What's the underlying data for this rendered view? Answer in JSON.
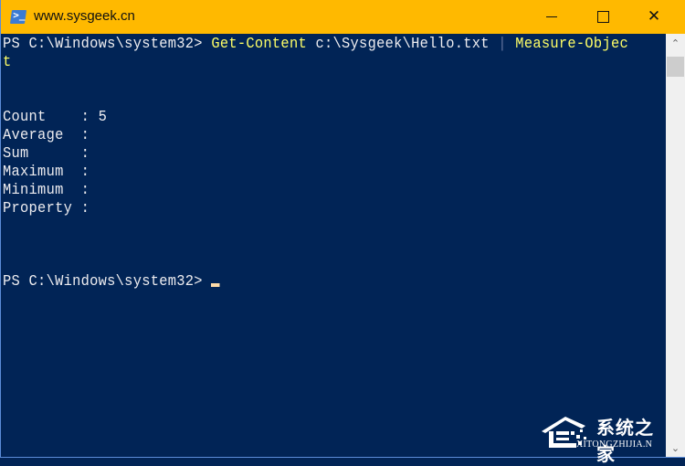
{
  "window": {
    "title": "www.sysgeek.cn",
    "icon": "powershell-icon",
    "icon_glyph": ">_",
    "controls": {
      "minimize_icon": "minimize-icon",
      "maximize_icon": "maximize-icon",
      "close_icon": "close-icon",
      "close_glyph": "✕"
    },
    "title_bar_color": "#ffb900"
  },
  "console": {
    "background": "#012456",
    "prompt1": "PS C:\\Windows\\system32> ",
    "command_cmdlet": "Get-Content",
    "command_arg": " c:\\Sysgeek\\Hello.txt ",
    "command_pipe": "|",
    "command_cmdlet2": " Measure-Objec",
    "command_wrap": "t",
    "output": [
      {
        "label": "Count    : 5"
      },
      {
        "label": "Average  :"
      },
      {
        "label": "Sum      :"
      },
      {
        "label": "Maximum  :"
      },
      {
        "label": "Minimum  :"
      },
      {
        "label": "Property :"
      }
    ],
    "prompt2": "PS C:\\Windows\\system32> "
  },
  "scrollbar": {
    "up_glyph": "⌃",
    "down_glyph": "⌄"
  },
  "watermark": {
    "text": "系统之家",
    "subtext": "XITONGZHIJIA.N"
  }
}
